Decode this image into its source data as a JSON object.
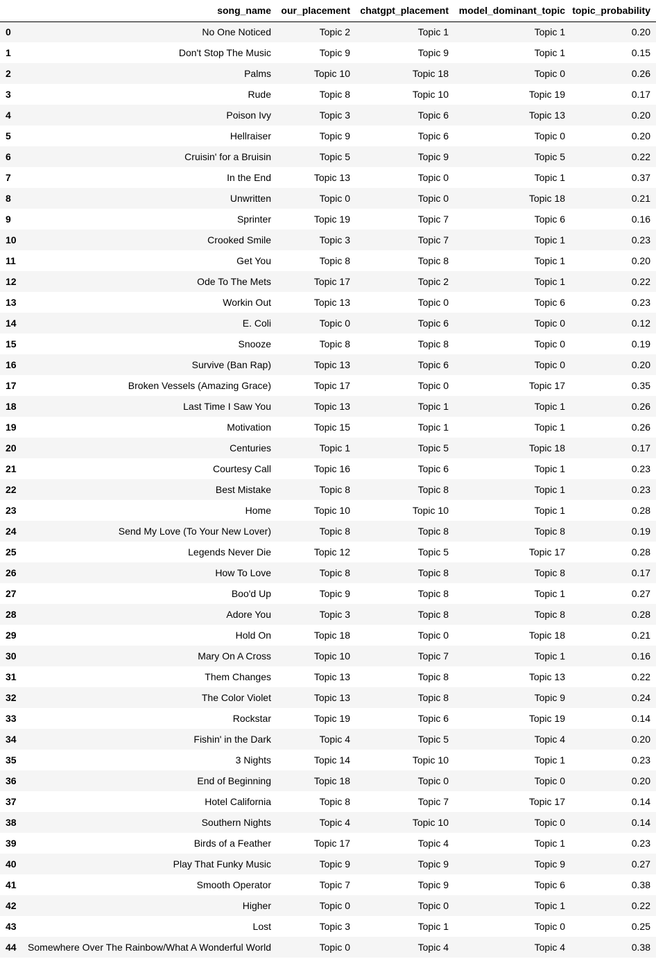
{
  "table": {
    "columns": [
      "",
      "song_name",
      "our_placement",
      "chatgpt_placement",
      "model_dominant_topic",
      "topic_probability"
    ],
    "rows": [
      [
        "0",
        "No One Noticed",
        "Topic 2",
        "Topic 1",
        "Topic 1",
        "0.20"
      ],
      [
        "1",
        "Don't Stop The Music",
        "Topic 9",
        "Topic 9",
        "Topic 1",
        "0.15"
      ],
      [
        "2",
        "Palms",
        "Topic 10",
        "Topic 18",
        "Topic 0",
        "0.26"
      ],
      [
        "3",
        "Rude",
        "Topic 8",
        "Topic 10",
        "Topic 19",
        "0.17"
      ],
      [
        "4",
        "Poison Ivy",
        "Topic 3",
        "Topic 6",
        "Topic 13",
        "0.20"
      ],
      [
        "5",
        "Hellraiser",
        "Topic 9",
        "Topic 6",
        "Topic 0",
        "0.20"
      ],
      [
        "6",
        "Cruisin' for a Bruisin",
        "Topic 5",
        "Topic 9",
        "Topic 5",
        "0.22"
      ],
      [
        "7",
        "In the End",
        "Topic 13",
        "Topic 0",
        "Topic 1",
        "0.37"
      ],
      [
        "8",
        "Unwritten",
        "Topic 0",
        "Topic 0",
        "Topic 18",
        "0.21"
      ],
      [
        "9",
        "Sprinter",
        "Topic 19",
        "Topic 7",
        "Topic 6",
        "0.16"
      ],
      [
        "10",
        "Crooked Smile",
        "Topic 3",
        "Topic 7",
        "Topic 1",
        "0.23"
      ],
      [
        "11",
        "Get You",
        "Topic 8",
        "Topic 8",
        "Topic 1",
        "0.20"
      ],
      [
        "12",
        "Ode To The Mets",
        "Topic 17",
        "Topic 2",
        "Topic 1",
        "0.22"
      ],
      [
        "13",
        "Workin Out",
        "Topic 13",
        "Topic 0",
        "Topic 6",
        "0.23"
      ],
      [
        "14",
        "E. Coli",
        "Topic 0",
        "Topic 6",
        "Topic 0",
        "0.12"
      ],
      [
        "15",
        "Snooze",
        "Topic 8",
        "Topic 8",
        "Topic 0",
        "0.19"
      ],
      [
        "16",
        "Survive (Ban Rap)",
        "Topic 13",
        "Topic 6",
        "Topic 0",
        "0.20"
      ],
      [
        "17",
        "Broken Vessels (Amazing Grace)",
        "Topic 17",
        "Topic 0",
        "Topic 17",
        "0.35"
      ],
      [
        "18",
        "Last Time I Saw You",
        "Topic 13",
        "Topic 1",
        "Topic 1",
        "0.26"
      ],
      [
        "19",
        "Motivation",
        "Topic 15",
        "Topic 1",
        "Topic 1",
        "0.26"
      ],
      [
        "20",
        "Centuries",
        "Topic 1",
        "Topic 5",
        "Topic 18",
        "0.17"
      ],
      [
        "21",
        "Courtesy Call",
        "Topic 16",
        "Topic 6",
        "Topic 1",
        "0.23"
      ],
      [
        "22",
        "Best Mistake",
        "Topic 8",
        "Topic 8",
        "Topic 1",
        "0.23"
      ],
      [
        "23",
        "Home",
        "Topic 10",
        "Topic 10",
        "Topic 1",
        "0.28"
      ],
      [
        "24",
        "Send My Love (To Your New Lover)",
        "Topic 8",
        "Topic 8",
        "Topic 8",
        "0.19"
      ],
      [
        "25",
        "Legends Never Die",
        "Topic 12",
        "Topic 5",
        "Topic 17",
        "0.28"
      ],
      [
        "26",
        "How To Love",
        "Topic 8",
        "Topic 8",
        "Topic 8",
        "0.17"
      ],
      [
        "27",
        "Boo'd Up",
        "Topic 9",
        "Topic 8",
        "Topic 1",
        "0.27"
      ],
      [
        "28",
        "Adore You",
        "Topic 3",
        "Topic 8",
        "Topic 8",
        "0.28"
      ],
      [
        "29",
        "Hold On",
        "Topic 18",
        "Topic 0",
        "Topic 18",
        "0.21"
      ],
      [
        "30",
        "Mary On A Cross",
        "Topic 10",
        "Topic 7",
        "Topic 1",
        "0.16"
      ],
      [
        "31",
        "Them Changes",
        "Topic 13",
        "Topic 8",
        "Topic 13",
        "0.22"
      ],
      [
        "32",
        "The Color Violet",
        "Topic 13",
        "Topic 8",
        "Topic 9",
        "0.24"
      ],
      [
        "33",
        "Rockstar",
        "Topic 19",
        "Topic 6",
        "Topic 19",
        "0.14"
      ],
      [
        "34",
        "Fishin' in the Dark",
        "Topic 4",
        "Topic 5",
        "Topic 4",
        "0.20"
      ],
      [
        "35",
        "3 Nights",
        "Topic 14",
        "Topic 10",
        "Topic 1",
        "0.23"
      ],
      [
        "36",
        "End of Beginning",
        "Topic 18",
        "Topic 0",
        "Topic 0",
        "0.20"
      ],
      [
        "37",
        "Hotel California",
        "Topic 8",
        "Topic 7",
        "Topic 17",
        "0.14"
      ],
      [
        "38",
        "Southern Nights",
        "Topic 4",
        "Topic 10",
        "Topic 0",
        "0.14"
      ],
      [
        "39",
        "Birds of a Feather",
        "Topic 17",
        "Topic 4",
        "Topic 1",
        "0.23"
      ],
      [
        "40",
        "Play That Funky Music",
        "Topic 9",
        "Topic 9",
        "Topic 9",
        "0.27"
      ],
      [
        "41",
        "Smooth Operator",
        "Topic 7",
        "Topic 9",
        "Topic 6",
        "0.38"
      ],
      [
        "42",
        "Higher",
        "Topic 0",
        "Topic 0",
        "Topic 1",
        "0.22"
      ],
      [
        "43",
        "Lost",
        "Topic 3",
        "Topic 1",
        "Topic 0",
        "0.25"
      ],
      [
        "44",
        "Somewhere Over The Rainbow/What A Wonderful World",
        "Topic 0",
        "Topic 4",
        "Topic 4",
        "0.38"
      ]
    ]
  }
}
